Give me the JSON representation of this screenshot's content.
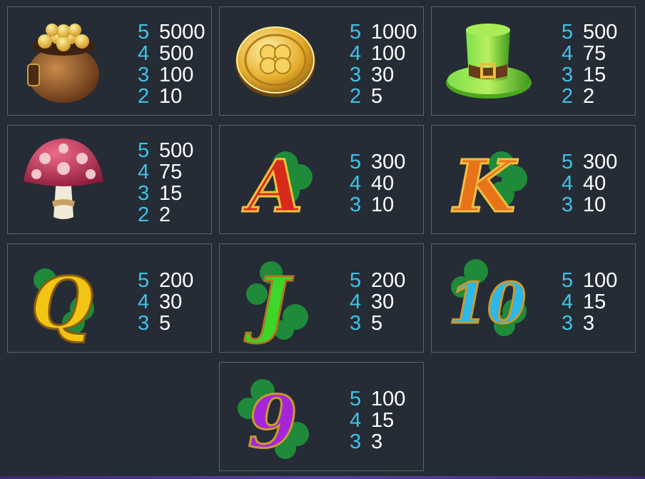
{
  "colors": {
    "background": "#252c35",
    "border": "#5a6270",
    "count_color": "#3fc3ea",
    "value_color": "#ffffff"
  },
  "symbols": [
    {
      "icon": "pot-of-gold-icon",
      "pays": [
        {
          "count": "5",
          "value": "5000"
        },
        {
          "count": "4",
          "value": "500"
        },
        {
          "count": "3",
          "value": "100"
        },
        {
          "count": "2",
          "value": "10"
        }
      ]
    },
    {
      "icon": "gold-clover-coin-icon",
      "pays": [
        {
          "count": "5",
          "value": "1000"
        },
        {
          "count": "4",
          "value": "100"
        },
        {
          "count": "3",
          "value": "30"
        },
        {
          "count": "2",
          "value": "5"
        }
      ]
    },
    {
      "icon": "leprechaun-hat-icon",
      "pays": [
        {
          "count": "5",
          "value": "500"
        },
        {
          "count": "4",
          "value": "75"
        },
        {
          "count": "3",
          "value": "15"
        },
        {
          "count": "2",
          "value": "2"
        }
      ]
    },
    {
      "icon": "mushroom-icon",
      "pays": [
        {
          "count": "5",
          "value": "500"
        },
        {
          "count": "4",
          "value": "75"
        },
        {
          "count": "3",
          "value": "15"
        },
        {
          "count": "2",
          "value": "2"
        }
      ]
    },
    {
      "icon": "letter-a-icon",
      "glyph": "A",
      "pays": [
        {
          "count": "5",
          "value": "300"
        },
        {
          "count": "4",
          "value": "40"
        },
        {
          "count": "3",
          "value": "10"
        }
      ]
    },
    {
      "icon": "letter-k-icon",
      "glyph": "K",
      "pays": [
        {
          "count": "5",
          "value": "300"
        },
        {
          "count": "4",
          "value": "40"
        },
        {
          "count": "3",
          "value": "10"
        }
      ]
    },
    {
      "icon": "letter-q-icon",
      "glyph": "Q",
      "pays": [
        {
          "count": "5",
          "value": "200"
        },
        {
          "count": "4",
          "value": "30"
        },
        {
          "count": "3",
          "value": "5"
        }
      ]
    },
    {
      "icon": "letter-j-icon",
      "glyph": "J",
      "pays": [
        {
          "count": "5",
          "value": "200"
        },
        {
          "count": "4",
          "value": "30"
        },
        {
          "count": "3",
          "value": "5"
        }
      ]
    },
    {
      "icon": "number-10-icon",
      "glyph": "10",
      "pays": [
        {
          "count": "5",
          "value": "100"
        },
        {
          "count": "4",
          "value": "15"
        },
        {
          "count": "3",
          "value": "3"
        }
      ]
    },
    {
      "icon": "number-9-icon",
      "glyph": "9",
      "pays": [
        {
          "count": "5",
          "value": "100"
        },
        {
          "count": "4",
          "value": "15"
        },
        {
          "count": "3",
          "value": "3"
        }
      ]
    }
  ]
}
